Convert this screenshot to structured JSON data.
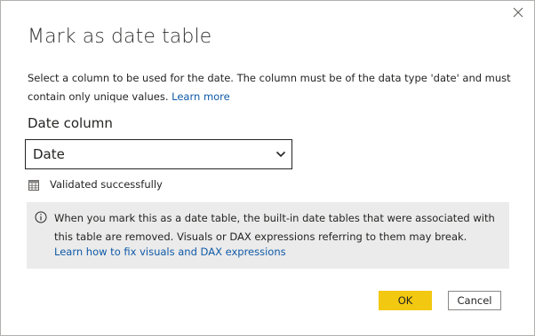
{
  "dialog": {
    "title": "Mark as date table",
    "description": "Select a column to be used for the date. The column must be of the data type 'date' and must contain only unique values.",
    "learn_more": "Learn more",
    "date_column_label": "Date column",
    "date_column_value": "Date",
    "validation_status": "Validated successfully",
    "info_text": "When you mark this as a date table, the built-in date tables that were associated with this table are removed. Visuals or DAX expressions referring to them may break.",
    "info_link": "Learn how to fix visuals and DAX expressions",
    "ok_label": "OK",
    "cancel_label": "Cancel"
  },
  "colors": {
    "primary_button": "#f2c811",
    "link": "#0f5aa8",
    "info_background": "#ebebeb"
  },
  "icons": [
    "close-icon",
    "chevron-down-icon",
    "calendar-table-icon",
    "info-icon"
  ]
}
